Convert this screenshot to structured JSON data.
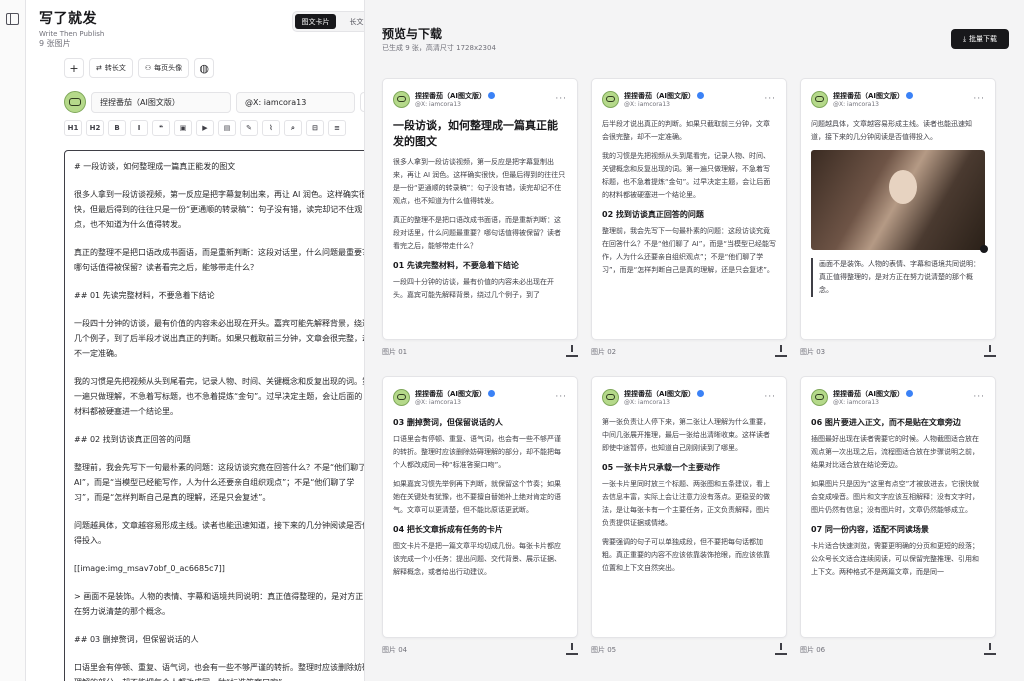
{
  "app": {
    "title": "写了就发",
    "subtitle": "Write Then Publish",
    "count": "9 张图片"
  },
  "mode": {
    "tabs": [
      "图文卡片",
      "长文"
    ],
    "active": 0
  },
  "toolbar": {
    "add": "+",
    "long_label": "转长文",
    "avatar_label": "每页头像",
    "palette": "◍"
  },
  "profile": {
    "name": "捏捏番茄（AI图文版）",
    "handle": "@X: iamcora13"
  },
  "format": [
    "H1",
    "H2",
    "B",
    "I",
    "❝",
    "▣",
    "▶",
    "▤",
    "✎",
    "⌇",
    "⌕",
    "⊟",
    "≡"
  ],
  "editor": {
    "lines": [
      "# 一段访谈，如何整理成一篇真正能发的图文",
      "很多人拿到一段访谈视频，第一反应是把字幕复制出来，再让 AI 润色。这样确实很快，但最后得到的往往只是一份“更通顺的转录稿”：句子没有错，读完却记不住观点，也不知道为什么值得转发。",
      "真正的整理不是把口语改成书面语，而是重新判断：这段对话里，什么问题最重要？哪句话值得被保留？读者看完之后，能够带走什么？",
      "## 01 先读完整材料，不要急着下结论",
      "一段四十分钟的访谈，最有价值的内容未必出现在开头。嘉宾可能先解释背景，绕过几个例子，到了后半段才说出真正的判断。如果只截取前三分钟，文章会很完整，却不一定准确。",
      "我的习惯是先把视频从头到尾看完，记录人物、时间、关键概念和反复出现的词。第一遍只做理解，不急着写标题，也不急着提炼“金句”。过早决定主题，会让后面的材料都被硬塞进一个结论里。",
      "## 02 找到访谈真正回答的问题",
      "整理前，我会先写下一句最朴素的问题：这段访谈究竟在回答什么？不是“他们聊了 AI”，而是“当模型已经能写作，人为什么还要亲自组织观点”；不是“他们聊了学习”，而是“怎样判断自己是真的理解，还是只会复述”。",
      "问题越具体，文章越容易形成主线。读者也能迅速知道，接下来的几分钟阅读是否值得投入。",
      "[[image:img_msav7obf_0_ac6685c7]]",
      "> 画面不是装饰。人物的表情、字幕和语境共同说明：真正值得整理的，是对方正在努力说清楚的那个概念。",
      "## 03 删掉赘词，但保留说话的人",
      "口语里会有停顿、重复、语气词，也会有一些不够严谨的转折。整理时应该删除妨碍理解的部分，却不能把每个人都改成同一种“标准答案口吻”。"
    ]
  },
  "preview": {
    "title": "预览与下载",
    "subtitle": "已生成 9 张，高清尺寸 1728x2304",
    "download_all": "批量下载"
  },
  "cards": [
    {
      "label": "图片 01",
      "title": "一段访谈，如何整理成一篇真正能发的图文",
      "paras": [
        "很多人拿到一段访谈视频，第一反应是把字幕复制出来，再让 AI 润色。这样确实很快，但最后得到的往往只是一份“更通顺的转录稿”：句子没有错，读完却记不住观点，也不知道为什么值得转发。",
        "真正的整理不是把口语改成书面语，而是重新判断：这段对话里，什么问题最重要？哪句话值得被保留？读者看完之后，能够带走什么？"
      ],
      "h3": "01 先读完整材料，不要急着下结论",
      "tail": "一段四十分钟的访谈，最有价值的内容未必出现在开头。嘉宾可能先解释背景，绕过几个例子，到了"
    },
    {
      "label": "图片 02",
      "title": "",
      "paras": [
        "后半段才说出真正的判断。如果只截取前三分钟，文章会很完整，却不一定准确。",
        "我的习惯是先把视频从头到尾看完，记录人物、时间、关键概念和反复出现的词。第一遍只做理解，不急着写标题，也不急着提炼“金句”。过早决定主题，会让后面的材料都被硬塞进一个结论里。"
      ],
      "h3": "02 找到访谈真正回答的问题",
      "tail": "整理前，我会先写下一句最朴素的问题：这段访谈究竟在回答什么？不是“他们聊了 AI”，而是“当模型已经能写作，人为什么还要亲自组织观点”；不是“他们聊了学习”，而是“怎样判断自己是真的理解，还是只会复述”。"
    },
    {
      "label": "图片 03",
      "title": "",
      "paras": [
        "问题越具体，文章越容易形成主线。读者也能迅速知道，接下来的几分钟阅读是否值得投入。"
      ],
      "h3": "",
      "tail": "",
      "image": true,
      "quote": "画面不是装饰。人物的表情、字幕和语境共同说明：真正值得整理的，是对方正在努力说清楚的那个概念。"
    },
    {
      "label": "图片 04",
      "title": "",
      "paras": [],
      "h3": "03 删掉赘词，但保留说话的人",
      "tail": "口语里会有停顿、重复、语气词，也会有一些不够严谨的转折。整理时应该删除妨碍理解的部分，却不能把每个人都改成同一种“标准答案口吻”。",
      "extra": [
        "如果嘉宾习惯先举例再下判断，就保留这个节奏；如果她在关键处有犹豫，也不要擅自替她补上绝对肯定的语气。文章可以更清楚，但不能比原话更武断。"
      ],
      "h3b": "04 把长文章拆成有任务的卡片",
      "tail2": "图文卡片不是把一篇文章平均切成几份。每张卡片都应该完成一个小任务：提出问题、交代背景、展示证据、解释概念，或者给出行动建议。"
    },
    {
      "label": "图片 05",
      "title": "",
      "paras": [
        "第一张负责让人停下来，第二张让人理解为什么重要，中间几张展开推理，最后一张给出清晰收束。这样读者即使中途暂停，也知道自己刚刚读到了哪里。"
      ],
      "h3": "05 一张卡片只承载一个主要动作",
      "tail": "一张卡片里同时放三个标题、两张图和五条建议，看上去信息丰富，实际上会让注意力没有落点。更稳妥的做法，是让每张卡有一个主要任务，正文负责解释，图片负责提供证据或情绪。",
      "extra": [
        "需要强调的句子可以单独成段，但不要把每句话都加粗。真正重要的内容不应该依靠装饰抢眼，而应该依靠位置和上下文自然突出。"
      ]
    },
    {
      "label": "图片 06",
      "title": "",
      "paras": [],
      "h3": "06 图片要进入正文，而不是贴在文章旁边",
      "tail": "插图最好出现在读者需要它的时候。人物截图适合放在观点第一次出现之后，流程图适合放在步骤说明之前，结果对比适合放在结论旁边。",
      "extra": [
        "如果图片只是因为“这里有点空”才被放进去，它很快就会变成噪音。图片和文字应该互相解释：没有文字时，图片仍然有信息；没有图片时，文章仍然能够成立。"
      ],
      "h3b": "07 同一份内容，适配不同读场景",
      "tail2": "卡片适合快速浏览，需要更明确的分页和更短的段落；公众号长文适合连续阅读，可以保留完整推理、引用和上下文。两种格式不是两篇文章，而是同一"
    }
  ]
}
